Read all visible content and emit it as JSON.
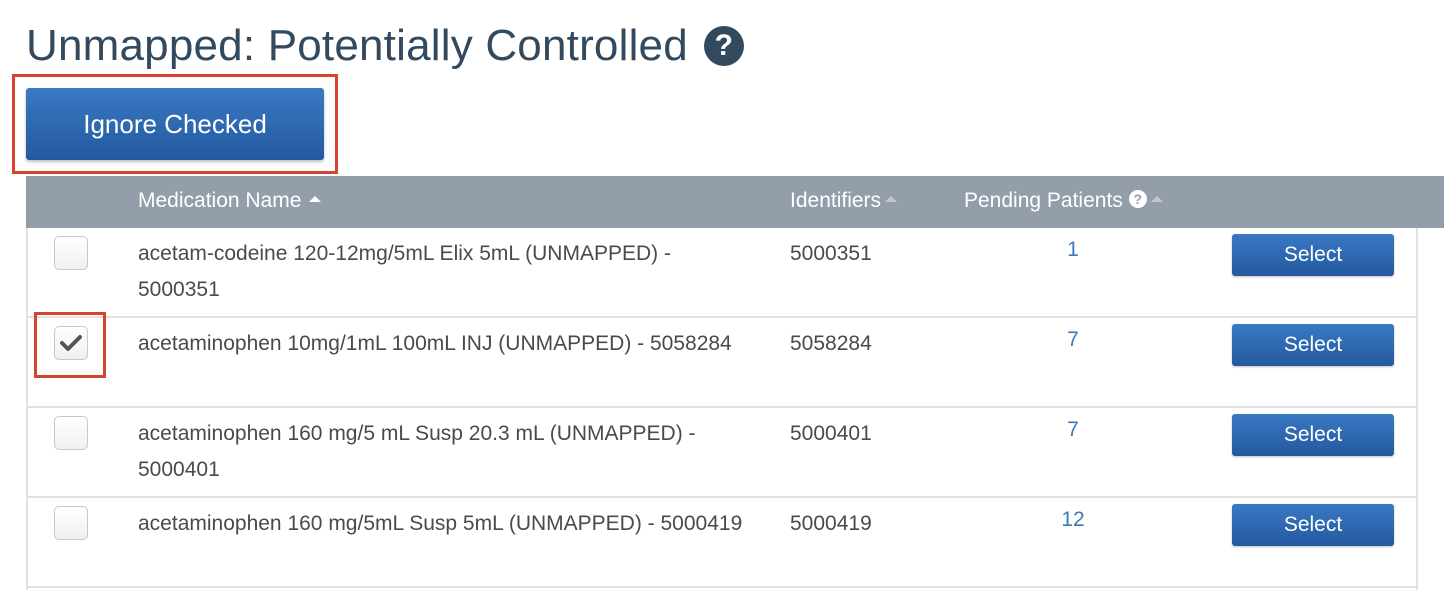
{
  "page": {
    "title": "Unmapped: Potentially Controlled",
    "help_icon": "question-circle-icon"
  },
  "toolbar": {
    "ignore_label": "Ignore Checked"
  },
  "table": {
    "columns": {
      "medication_name": "Medication Name",
      "identifiers": "Identifiers",
      "pending_patients": "Pending Patients"
    },
    "sort": {
      "column": "Medication Name",
      "direction": "ascending"
    },
    "select_label": "Select",
    "rows": [
      {
        "checked": false,
        "name": "acetam-codeine 120-12mg/5mL Elix 5mL (UNMAPPED) - 5000351",
        "identifier": "5000351",
        "pending": "1"
      },
      {
        "checked": true,
        "name": "acetaminophen 10mg/1mL 100mL INJ (UNMAPPED) - 5058284",
        "identifier": "5058284",
        "pending": "7"
      },
      {
        "checked": false,
        "name": "acetaminophen 160 mg/5 mL Susp 20.3 mL (UNMAPPED) - 5000401",
        "identifier": "5000401",
        "pending": "7"
      },
      {
        "checked": false,
        "name": "acetaminophen 160 mg/5mL Susp 5mL (UNMAPPED) - 5000419",
        "identifier": "5000419",
        "pending": "12"
      }
    ]
  },
  "colors": {
    "title": "#334a5e",
    "primary_button": "#2f6bb4",
    "table_header": "#949eab",
    "link": "#3d7ab8",
    "highlight": "#d6442f"
  }
}
